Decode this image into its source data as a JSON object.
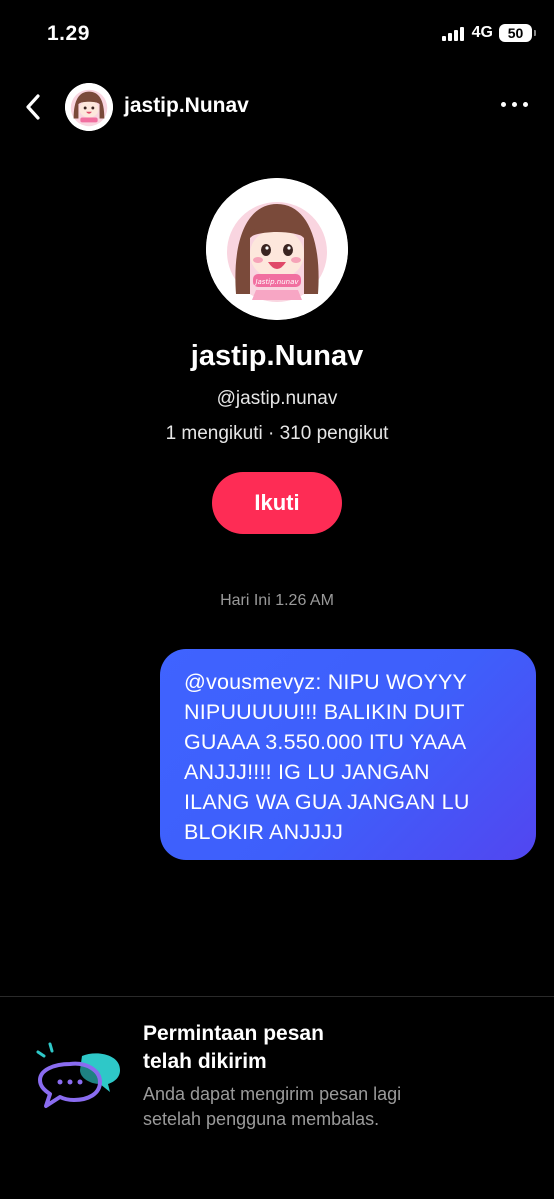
{
  "status_bar": {
    "time": "1.29",
    "network": "4G",
    "battery": "50"
  },
  "nav": {
    "username": "jastip.Nunav"
  },
  "profile": {
    "display_name": "jastip.Nunav",
    "handle": "@jastip.nunav",
    "stats": "1 mengikuti · 310 pengikut",
    "follow_label": "Ikuti",
    "avatar_caption": "Jastip.nunav"
  },
  "chat": {
    "timestamp": "Hari Ini 1.26 AM",
    "message_lines": [
      "@vousmevyz: NIPU WOYYY",
      "NIPUUUUU!!! BALIKIN DUIT",
      "GUAAA 3.550.000 ITU YAAA",
      "ANJJJ!!!! IG LU JANGAN",
      "ILANG WA GUA JANGAN LU",
      "BLOKIR ANJJJJ"
    ]
  },
  "notice": {
    "title_lines": [
      "Permintaan pesan",
      "telah dikirim"
    ],
    "description_lines": [
      "Anda dapat mengirim pesan lagi",
      "setelah pengguna membalas."
    ]
  },
  "colors": {
    "follow_button": "#fe2c55",
    "bubble_start": "#3f63ff",
    "bubble_end": "#5246f0",
    "icon_purple": "#8a6cf0",
    "icon_teal": "#2ec8c8"
  },
  "icons": {
    "back": "chevron-left-icon",
    "more": "ellipsis-icon",
    "notice": "chat-bubbles-icon"
  }
}
